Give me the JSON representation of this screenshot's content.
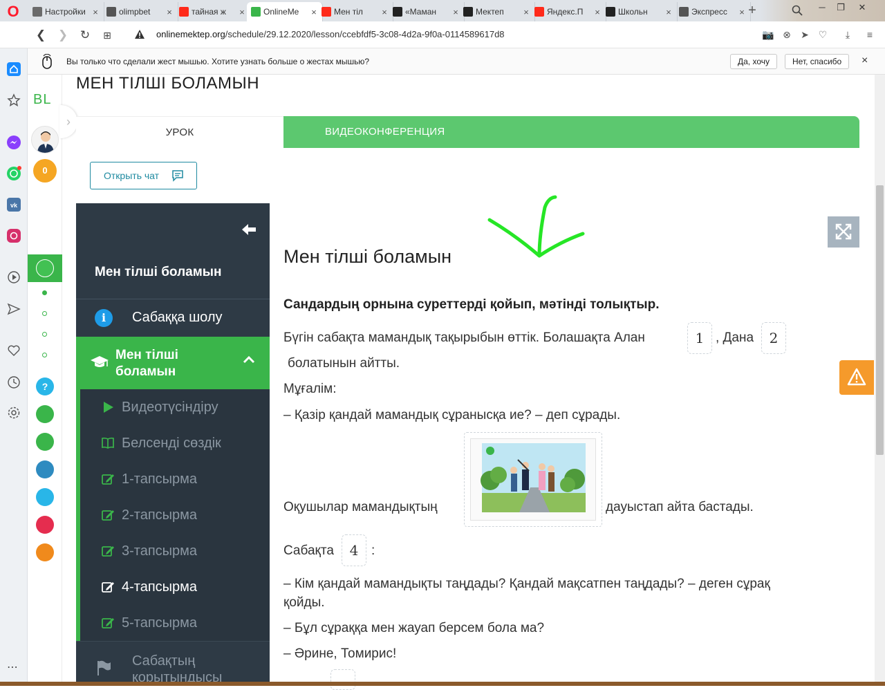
{
  "browser": {
    "tabs": [
      {
        "title": "Настройки",
        "icon": "gear-icon",
        "color": "#6b6b6b"
      },
      {
        "title": "olimpbet",
        "icon": "document-icon",
        "color": "#555555"
      },
      {
        "title": "тайная ж",
        "icon": "yandex-icon",
        "color": "#ff2a1a"
      },
      {
        "title": "OnlineMe",
        "icon": "onlinemektep-icon",
        "color": "#3ab54a",
        "active": true
      },
      {
        "title": "Мен тіл",
        "icon": "yandex-icon",
        "color": "#ff2a1a"
      },
      {
        "title": "«Маман",
        "icon": "z-icon",
        "color": "#222222"
      },
      {
        "title": "Мектеп",
        "icon": "z-icon",
        "color": "#222222"
      },
      {
        "title": "Яндекс.П",
        "icon": "yandex-icon",
        "color": "#ff2a1a"
      },
      {
        "title": "Школьн",
        "icon": "z-icon",
        "color": "#222222"
      },
      {
        "title": "Экспресс",
        "icon": "grid-icon",
        "color": "#555555"
      }
    ],
    "url_host": "onlinemektep.org",
    "url_path": "/schedule/29.12.2020/lesson/ccebfdf5-3c08-4d2a-9f0a-0114589617d8"
  },
  "gesture": {
    "message": "Вы только что сделали жест мышью. Хотите узнать больше о жестах мышью?",
    "yes_label": "Да, хочу",
    "no_label": "Нет, спасибо",
    "close_label": "×"
  },
  "rail": {
    "logo": "BL",
    "coins": "0"
  },
  "page": {
    "title": "МЕН ТІЛШІ БОЛАМЫН",
    "tab_lesson": "УРОК",
    "tab_video": "ВИДЕОКОНФЕРЕНЦИЯ",
    "open_chat": "Открыть чат"
  },
  "nav": {
    "title": "Мен тілші боламын",
    "overview": "Сабаққа шолу",
    "current": "Мен тілші боламын",
    "items": [
      {
        "label": "Видеотүсіндіру",
        "icon": "play-icon"
      },
      {
        "label": "Белсенді сөздік",
        "icon": "book-icon"
      },
      {
        "label": "1-тапсырма",
        "icon": "edit-icon"
      },
      {
        "label": "2-тапсырма",
        "icon": "edit-icon"
      },
      {
        "label": "3-тапсырма",
        "icon": "edit-icon"
      },
      {
        "label": "4-тапсырма",
        "icon": "edit-icon",
        "current": true
      },
      {
        "label": "5-тапсырма",
        "icon": "edit-icon"
      }
    ],
    "summary": "Сабақтың қорытындысы"
  },
  "lesson": {
    "heading": "Мен тілші боламын",
    "instruction": "Сандардың орнына суреттерді қойып, мәтінді толықтыр.",
    "line1_a": "Бүгін сабақта мамандық тақырыбын өттік. Болашақта Алан",
    "slot1": "1",
    "line1_b": ", Дана",
    "slot2": "2",
    "line2": "болатынын айтты.",
    "line3": "Мұғалім:",
    "line4": "– Қазір қандай мамандық сұранысқа ие? – деп сұрады.",
    "line5_a": "Оқушылар мамандықтың",
    "line5_b": "дауыстап айта бастады.",
    "line6_a": "Сабақта",
    "slot4": "4",
    "line6_b": ":",
    "line7": "– Кім қандай мамандықты таңдады? Қандай мақсатпен таңдады? – деген сұрақ",
    "line7b": "қойды.",
    "line8": "– Бұл сұраққа мен жауап берсем бола ма?",
    "line9": "– Әрине, Томирис!"
  },
  "colors": {
    "green": "#3ab54a",
    "nav_dark": "#2e3a45",
    "chat_teal": "#1e8aa0",
    "warning": "#f59a2b"
  }
}
